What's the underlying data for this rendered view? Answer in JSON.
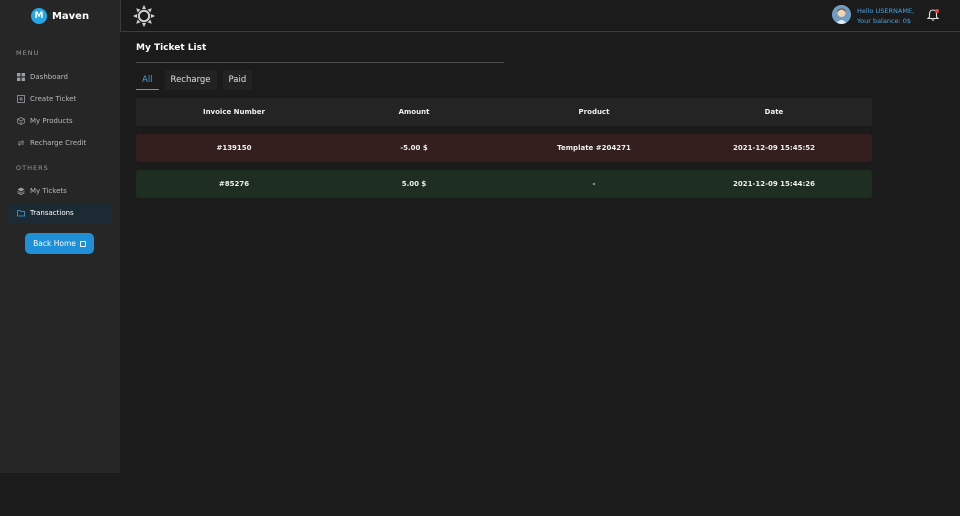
{
  "brand": {
    "logo_letter": "M",
    "name": "Maven"
  },
  "sidebar": {
    "menu_title": "MENU",
    "others_title": "OTHERS",
    "items": [
      {
        "label": "Dashboard",
        "icon": "grid-icon"
      },
      {
        "label": "Create Ticket",
        "icon": "plus-square-icon"
      },
      {
        "label": "My Products",
        "icon": "box-icon"
      },
      {
        "label": "Recharge Credit",
        "icon": "refresh-icon"
      },
      {
        "label": "My Tickets",
        "icon": "layers-icon"
      },
      {
        "label": "Transactions",
        "icon": "folder-icon",
        "active": true
      }
    ],
    "back_home": "Back Home"
  },
  "header": {
    "greeting": "Hello USERNAME,",
    "balance": "Your balance: 0$",
    "accent": "#4aa3df"
  },
  "main": {
    "title": "My Ticket List",
    "tabs": [
      {
        "label": "All",
        "active": true
      },
      {
        "label": "Recharge"
      },
      {
        "label": "Paid"
      }
    ],
    "columns": [
      "Invoice Number",
      "Amount",
      "Product",
      "Date"
    ],
    "rows": [
      {
        "invoice": "#139150",
        "amount": "-5.00 $",
        "product": "Template #204271",
        "date": "2021-12-09 15:45:52",
        "status_color": "#331f1e"
      },
      {
        "invoice": "#85276",
        "amount": "5.00 $",
        "product": "-",
        "date": "2021-12-09 15:44:26",
        "status_color": "#1e2e22"
      }
    ]
  }
}
